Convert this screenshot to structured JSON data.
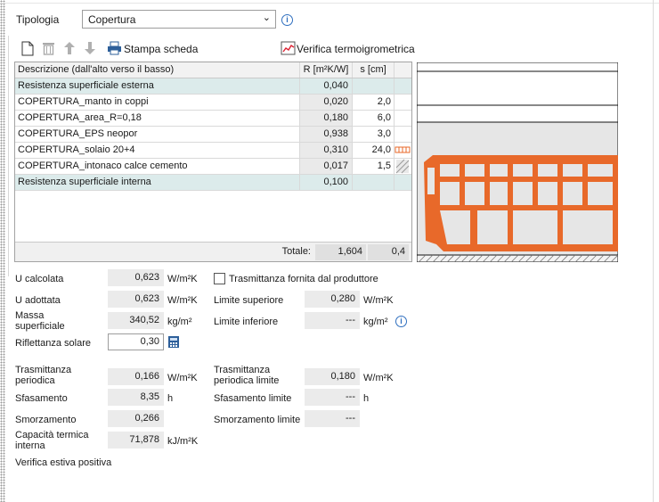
{
  "tipologia": {
    "label": "Tipologia",
    "value": "Copertura"
  },
  "toolbar": {
    "new_icon": "document-icon",
    "delete_icon": "trash-icon",
    "up_icon": "arrow-up-icon",
    "down_icon": "arrow-down-icon",
    "print_label": "Stampa scheda",
    "verify_label": "Verifica termoigrometrica"
  },
  "table": {
    "headers": {
      "description": "Descrizione (dall'alto verso il basso)",
      "r": "R [m²K/W]",
      "s": "s [cm]"
    },
    "rows": [
      {
        "description": "Resistenza superficiale esterna",
        "r": "0,040",
        "s": "",
        "highlight": true
      },
      {
        "description": "COPERTURA_manto in coppi",
        "r": "0,020",
        "s": "2,0",
        "highlight": false
      },
      {
        "description": "COPERTURA_area_R=0,18",
        "r": "0,180",
        "s": "6,0",
        "highlight": false
      },
      {
        "description": "COPERTURA_EPS neopor",
        "r": "0,938",
        "s": "3,0",
        "highlight": false
      },
      {
        "description": "COPERTURA_solaio 20+4",
        "r": "0,310",
        "s": "24,0",
        "highlight": false
      },
      {
        "description": "COPERTURA_intonaco calce cemento",
        "r": "0,017",
        "s": "1,5",
        "highlight": false
      },
      {
        "description": "Resistenza superficiale interna",
        "r": "0,100",
        "s": "",
        "highlight": true
      }
    ],
    "total_label": "Totale:",
    "total_r": "1,604",
    "total_s": "0,4"
  },
  "results": {
    "u_calcolata": {
      "label": "U calcolata",
      "value": "0,623",
      "unit": "W/m²K"
    },
    "trasmittanza_produttore": {
      "label": "Trasmittanza fornita dal produttore",
      "checked": false
    },
    "u_adottata": {
      "label": "U adottata",
      "value": "0,623",
      "unit": "W/m²K"
    },
    "limite_superiore": {
      "label": "Limite superiore",
      "value": "0,280",
      "unit": "W/m²K"
    },
    "massa": {
      "label_line1": "Massa",
      "label_line2": "superficiale",
      "value": "340,52",
      "unit": "kg/m²"
    },
    "limite_inferiore": {
      "label": "Limite inferiore",
      "value": "---",
      "unit": "kg/m²"
    },
    "riflettanza": {
      "label": "Riflettanza solare",
      "value": "0,30"
    },
    "trasm_periodica": {
      "label_line1": "Trasmittanza",
      "label_line2": "periodica",
      "value": "0,166",
      "unit": "W/m²K"
    },
    "trasm_periodica_limite": {
      "label_line1": "Trasmittanza",
      "label_line2": "periodica limite",
      "value": "0,180",
      "unit": "W/m²K"
    },
    "sfasamento": {
      "label": "Sfasamento",
      "value": "8,35",
      "unit": "h"
    },
    "sfasamento_limite": {
      "label": "Sfasamento limite",
      "value": "---",
      "unit": "h"
    },
    "smorzamento": {
      "label": "Smorzamento",
      "value": "0,266"
    },
    "smorzamento_limite": {
      "label": "Smorzamento limite",
      "value": "---"
    },
    "capacita": {
      "label_line1": "Capacità termica",
      "label_line2": "interna",
      "value": "71,878",
      "unit": "kJ/m²K"
    },
    "verifica_estiva": "Verifica estiva positiva"
  },
  "colors": {
    "brick": "#e8692a",
    "highlight_row": "#dcebeb",
    "accent_icon": "#2f6fbf"
  }
}
